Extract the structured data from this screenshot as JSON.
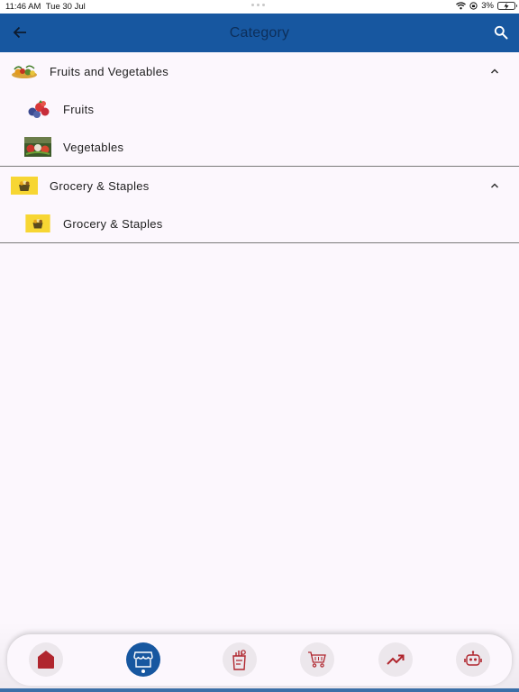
{
  "status_bar": {
    "time": "11:46 AM",
    "date": "Tue 30 Jul",
    "battery": "3%"
  },
  "app_bar": {
    "title": "Category",
    "back_icon": "arrow-left-icon",
    "search_icon": "search-icon"
  },
  "categories": [
    {
      "label": "Fruits and Vegetables",
      "thumb_icon": "fruits-vegetables-image",
      "expanded": true,
      "items": [
        {
          "label": "Fruits",
          "thumb_icon": "berries-image"
        },
        {
          "label": "Vegetables",
          "thumb_icon": "vegetables-image"
        }
      ]
    },
    {
      "label": "Grocery & Staples",
      "thumb_icon": "grocery-basket-image",
      "expanded": true,
      "items": [
        {
          "label": "Grocery & Staples",
          "thumb_icon": "grocery-basket-image"
        }
      ]
    }
  ],
  "bottom_nav": {
    "items": [
      {
        "icon": "home-icon",
        "active": false
      },
      {
        "icon": "store-icon",
        "active": true
      },
      {
        "icon": "grocery-bag-icon",
        "active": false
      },
      {
        "icon": "cart-icon",
        "active": false
      },
      {
        "icon": "trending-up-icon",
        "active": false
      },
      {
        "icon": "robot-icon",
        "active": false
      }
    ]
  },
  "colors": {
    "primary": "#1757a0",
    "background": "#fcf7fd",
    "icon_red": "#b0262e"
  }
}
